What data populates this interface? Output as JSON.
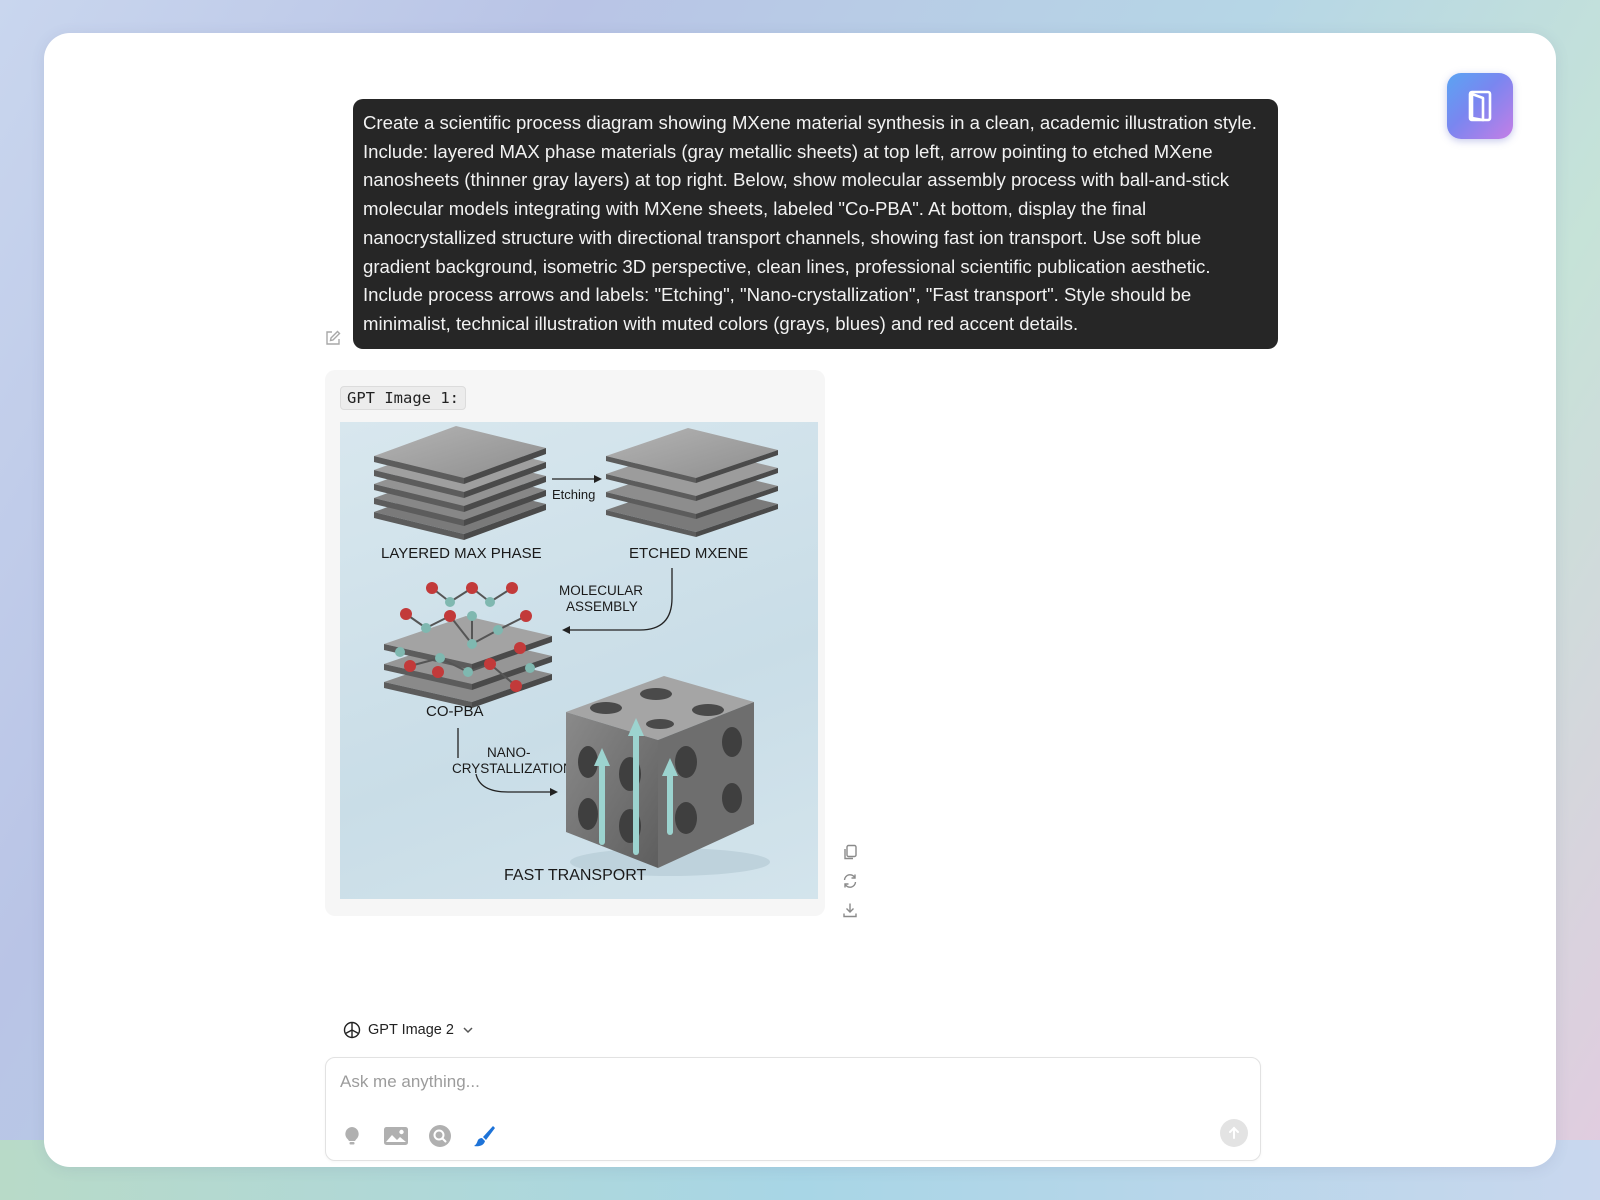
{
  "app": {
    "logo_icon": "door-logo-icon"
  },
  "prompt": {
    "text": "Create a scientific process diagram showing MXene material synthesis in a clean, academic illustration style. Include: layered MAX phase materials (gray metallic sheets) at top left, arrow pointing to etched MXene nanosheets (thinner gray layers) at top right. Below, show molecular assembly process with ball-and-stick molecular models integrating with MXene sheets, labeled \"Co-PBA\". At bottom, display the final nanocrystallized structure with directional transport channels, showing fast ion transport. Use soft blue gradient background, isometric 3D perspective, clean lines, professional scientific publication aesthetic. Include process arrows and labels: \"Etching\", \"Nano-crystallization\", \"Fast transport\". Style should be minimalist, technical illustration with muted colors (grays, blues) and red accent details."
  },
  "result": {
    "title": "GPT Image 1:",
    "image_labels": {
      "max_phase": "LAYERED MAX PHASE",
      "etching": "Etching",
      "etched_mxene": "ETCHED MXENE",
      "molecular_line1": "MOLECULAR",
      "molecular_line2": "ASSEMBLY",
      "co_pba": "CO-PBA",
      "nano_line1": "NANO-",
      "nano_line2": "CRYSTALLIZATION",
      "fast_transport": "FAST TRANSPORT"
    },
    "actions": [
      "copy-icon",
      "regenerate-icon",
      "download-icon"
    ]
  },
  "composer": {
    "model_name": "GPT Image 2",
    "placeholder": "Ask me anything...",
    "tools": [
      "lightbulb-icon",
      "image-icon",
      "search-icon",
      "paintbrush-icon"
    ],
    "accent_color": "#1e73d8"
  }
}
